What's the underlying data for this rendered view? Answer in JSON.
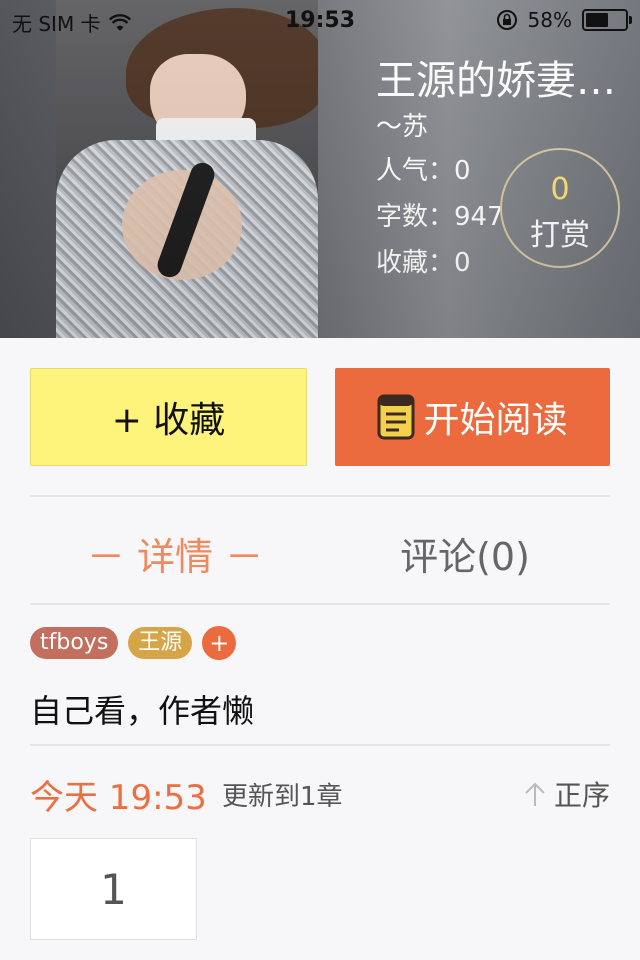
{
  "status_bar": {
    "carrier": "无 SIM 卡",
    "time": "19:53",
    "battery_percent": "58%",
    "battery_level": 0.58
  },
  "book": {
    "title": "王源的娇妻…",
    "author": "～苏",
    "stats": {
      "popularity_label": "人气：",
      "popularity_value": "0",
      "words_label": "字数：",
      "words_value": "947",
      "favorites_label": "收藏：",
      "favorites_value": "0"
    },
    "tip": {
      "count": "0",
      "label": "打赏"
    }
  },
  "actions": {
    "favorite_label": "+ 收藏",
    "read_label": "开始阅读"
  },
  "tabs": {
    "detail_label": "－ 详情 －",
    "comments_label": "评论(0)"
  },
  "tags": [
    "tfboys",
    "王源"
  ],
  "tag_add_label": "+",
  "description": "自己看，作者懒",
  "update": {
    "time": "今天 19:53",
    "text": "更新到1章",
    "order_label": "正序"
  },
  "chapters": [
    "1"
  ],
  "colors": {
    "accent_orange": "#eb6b3e",
    "favorite_yellow": "#fef37b",
    "tip_count": "#ffe270",
    "tag_tfboys": "#c36f5f",
    "tag_wangyuan": "#d6a548"
  }
}
